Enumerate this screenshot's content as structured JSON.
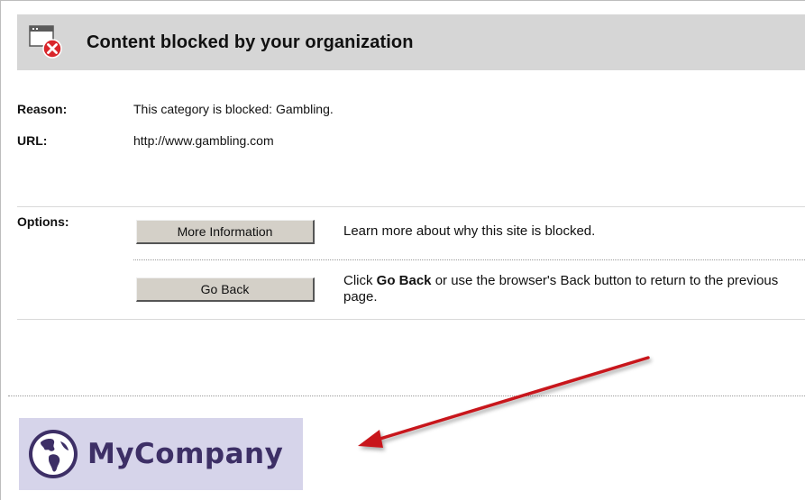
{
  "header": {
    "title": "Content blocked by your organization",
    "icon": "blocked-window-icon"
  },
  "details": {
    "reason_label": "Reason:",
    "reason_value": "This category is blocked: Gambling.",
    "url_label": "URL:",
    "url_value": "http://www.gambling.com"
  },
  "options": {
    "label": "Options:",
    "more_info_button": "More Information",
    "more_info_desc": "Learn more about why this site is blocked.",
    "go_back_button": "Go Back",
    "go_back_desc_prefix": "Click ",
    "go_back_desc_bold": "Go Back",
    "go_back_desc_suffix": " or use the browser's Back button to return to the previous page."
  },
  "branding": {
    "company_name": "MyCompany",
    "logo_icon": "globe-icon",
    "logo_bg_color": "#d6d4ea",
    "logo_text_color": "#3d2f66"
  },
  "annotation": {
    "arrow_color": "#c8191c",
    "icon": "red-arrow-icon"
  },
  "colors": {
    "header_bg": "#d6d6d6",
    "button_bg": "#d4d0c8",
    "error_red": "#d9262b"
  }
}
